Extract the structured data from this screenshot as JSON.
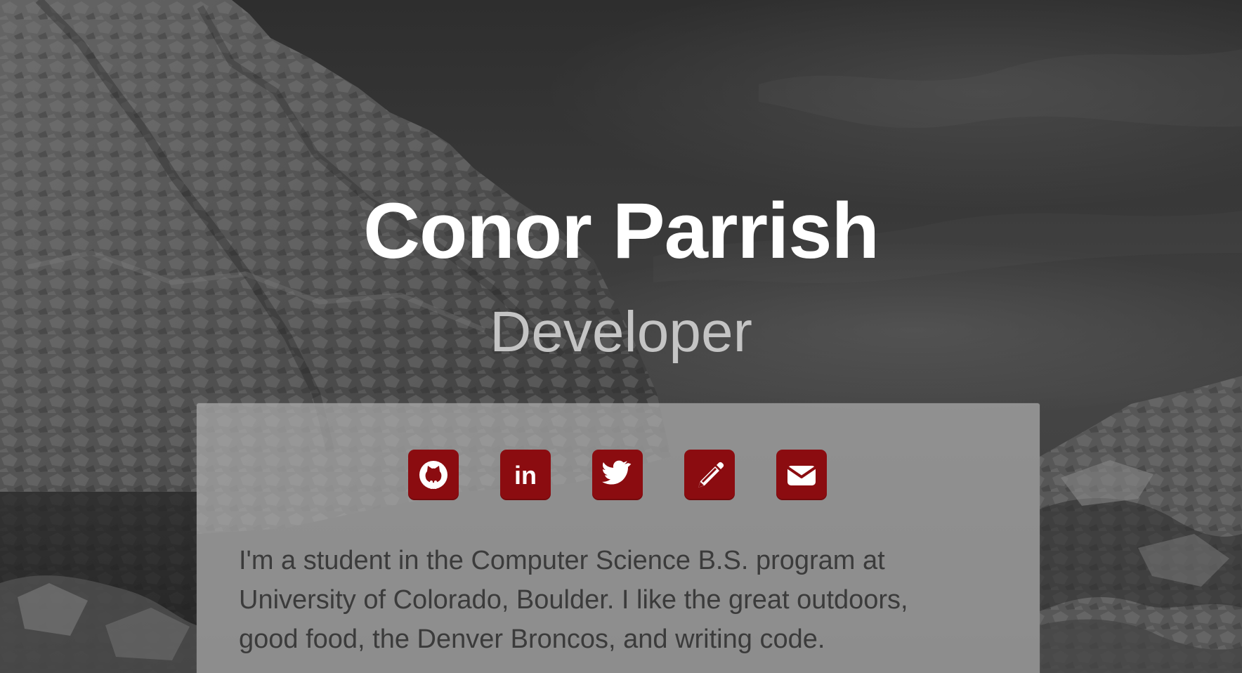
{
  "profile": {
    "name": "Conor Parrish",
    "role": "Developer"
  },
  "social_links": [
    {
      "label": "GitHub",
      "icon": "github-icon"
    },
    {
      "label": "LinkedIn",
      "icon": "linkedin-icon",
      "text": "in"
    },
    {
      "label": "Twitter",
      "icon": "twitter-icon"
    },
    {
      "label": "Blog",
      "icon": "pencil-icon"
    },
    {
      "label": "Email",
      "icon": "envelope-icon"
    }
  ],
  "bio": "I'm a student in the Computer Science B.S. program at University of Colorado, Boulder. I like the great outdoors, good food, the Denver Broncos, and writing code.",
  "colors": {
    "accent": "#8b0c10",
    "panel": "#b0b0b0",
    "heading": "#ffffff",
    "subheading": "#c4c4c4",
    "text": "#3b3b3b"
  }
}
